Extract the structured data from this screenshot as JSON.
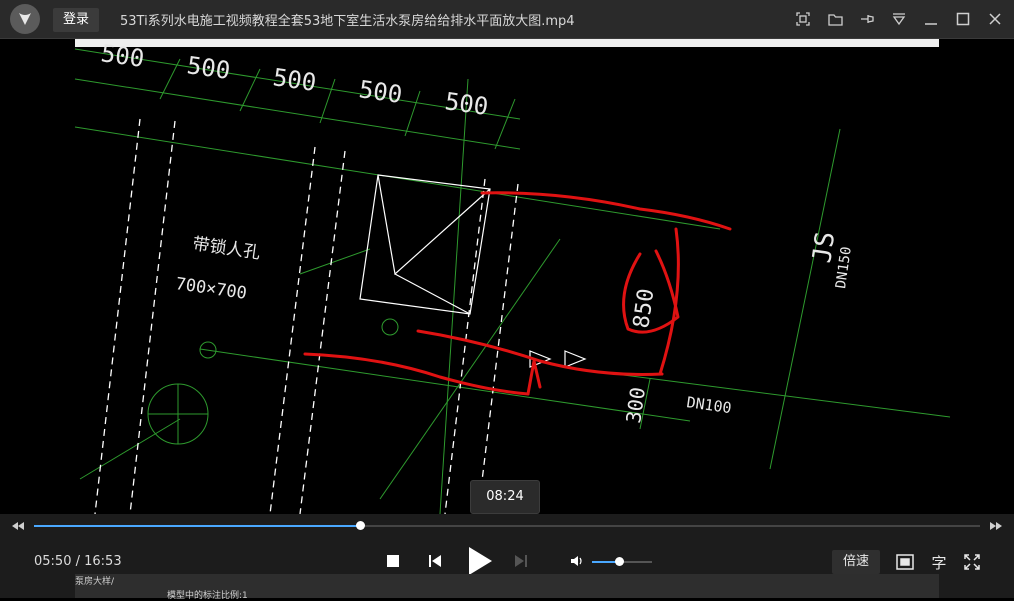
{
  "titlebar": {
    "login_label": "登录",
    "title": "53Ti系列水电施工视频教程全套53地下室生活水泵房给给排水平面放大图.mp4"
  },
  "video_frame": {
    "dims": [
      "500",
      "500",
      "500",
      "500",
      "500"
    ],
    "manhole_label": "带锁人孔",
    "manhole_size": "700×700",
    "dim_850": "850",
    "dim_300": "300",
    "dn150": "DN150",
    "dn100": "DN100",
    "js_label": "JS",
    "bottom_text1": "泵房大样/",
    "bottom_text2": "模型中的标注比例:1"
  },
  "player": {
    "hover_time": "08:24",
    "current_time": "05:50",
    "total_time": "16:53",
    "time_separator": " / ",
    "progress": 0.345,
    "volume": 0.45,
    "speed_label": "倍速",
    "subtitle_label": "字"
  }
}
